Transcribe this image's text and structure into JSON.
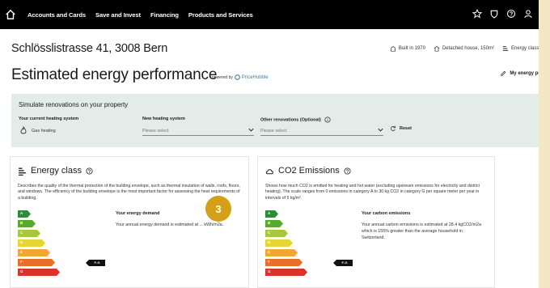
{
  "nav": {
    "items": [
      "Accounts and Cards",
      "Save and Invest",
      "Financing",
      "Products and Services"
    ]
  },
  "property": {
    "address": "Schlösslistrasse 41, 3008 Bern",
    "built": "Built in 1970",
    "house": "Detached house, 150m²",
    "energy_class": "Energy class: F-G"
  },
  "page": {
    "title": "Estimated energy performance",
    "powered_by": "powered by",
    "brand": "PriceHubble",
    "profile_link": "My energy profile"
  },
  "simulate": {
    "title": "Simulate renovations on your property",
    "current_label": "Your current heating system",
    "current_value": "Gas heating",
    "new_label": "New heating system",
    "new_placeholder": "Please select",
    "other_label": "Other renovations (Optional)",
    "other_placeholder": "Please select",
    "reset_label": "Reset"
  },
  "energy_card": {
    "title": "Energy class",
    "description": "Describes the quality of the thermal protection of the building envelope, such as thermal insulation of walls, roofs, floors, and windows. The efficiency of the building envelope is the most important factor for assessing the heat requirements of a building.",
    "subheading": "Your energy demand",
    "subtext": "Your annual energy demand is estimated at ... kWh/m2a.",
    "marker": "F-G",
    "classes": [
      "A",
      "B",
      "C",
      "D",
      "E",
      "F",
      "G"
    ]
  },
  "co2_card": {
    "title": "CO2 Emissions",
    "description": "Shows how much CO2 is emitted for heating and hot water (excluding upstream emissions for electricity and district heating). The scale ranges from 0 emissions in category A to 30 kg CO2 in category G per square meter per year in intervals of 5 kg/m².",
    "subheading": "Your carbon emissions",
    "subtext": "Your annual carbon emissions is estimated at 28.4 kgCO2/m2a which is 155% greater than the average household in Switzerland.",
    "marker": "F-G",
    "classes": [
      "A",
      "B",
      "C",
      "D",
      "E",
      "F",
      "G"
    ]
  },
  "colors": {
    "A": "#2e8b3a",
    "B": "#5aa832",
    "C": "#a6c83a",
    "D": "#e5d536",
    "E": "#f0a830",
    "F": "#e8712a",
    "G": "#d9342b"
  },
  "badge": "3"
}
